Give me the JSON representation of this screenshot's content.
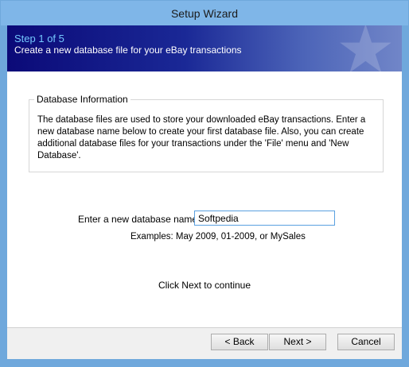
{
  "window": {
    "title": "Setup Wizard"
  },
  "banner": {
    "step": "Step 1 of 5",
    "description": "Create a new database file for your eBay transactions"
  },
  "group": {
    "legend": "Database Information",
    "text": "The database files are used to store your downloaded eBay transactions. Enter a new database name below to create your first database file. Also, you can create additional database files for your transactions under the 'File' menu and 'New Database'."
  },
  "form": {
    "label": "Enter a new database name:",
    "value": "Softpedia",
    "examples": "Examples:  May 2009,  01-2009, or MySales"
  },
  "instruction": "Click Next to continue",
  "buttons": {
    "back": "< Back",
    "next": "Next >",
    "cancel": "Cancel"
  },
  "colors": {
    "banner_start": "#0b0a78",
    "banner_end": "#7186c8",
    "step_text": "#74c8ff",
    "window_frame": "#6fa8dc"
  }
}
